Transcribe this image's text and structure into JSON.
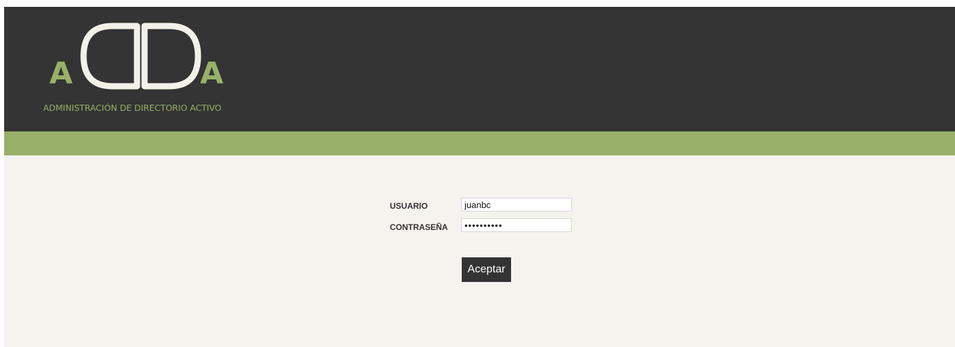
{
  "header": {
    "logo_letters": "aDDa",
    "logo_subtitle": "ADMINISTRACIÓN DE DIRECTORIO ACTIVO"
  },
  "login": {
    "username_label": "USUARIO",
    "username_value": "juanbc",
    "password_label": "CONTRASEÑA",
    "password_value": "••••••••••",
    "submit_label": "Aceptar"
  },
  "colors": {
    "header_bg": "#333433",
    "accent_green": "#98b068",
    "logo_cream": "#f2f1e9",
    "content_bg": "#f4f3ee"
  }
}
